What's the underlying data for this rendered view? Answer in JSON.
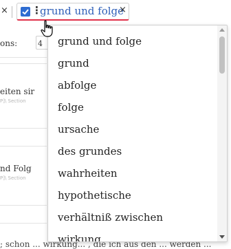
{
  "chip_bar": {
    "prev_close_glyph": "×",
    "active_chip": {
      "label": "grund und folge",
      "close_glyph": "×",
      "drag_handle_glyph": "⋮",
      "checked": true,
      "accent_color": "#2e6cd1",
      "underline_color": "#e0304a"
    }
  },
  "background": {
    "options_label_fragment": "ons:",
    "options_value_fragment": "4",
    "row1_text_fragment": "eiten sir",
    "row1_meta_fragment": "P]\\ Section",
    "row2_text_fragment": "nd Folg",
    "row2_meta_fragment": "P]\\ Section",
    "bottom_text_fragment": "; schon ... wirkung... , die ich aus den ... werden ..."
  },
  "dropdown": {
    "items": [
      "grund und folge",
      "grund",
      "abfolge",
      "folge",
      "ursache",
      "des grundes",
      "wahrheiten",
      "hypothetische",
      "verhältniß zwischen",
      "wirkung"
    ],
    "scrollbar": {
      "up_icon": "triangle-up",
      "down_icon": "triangle-down"
    }
  }
}
